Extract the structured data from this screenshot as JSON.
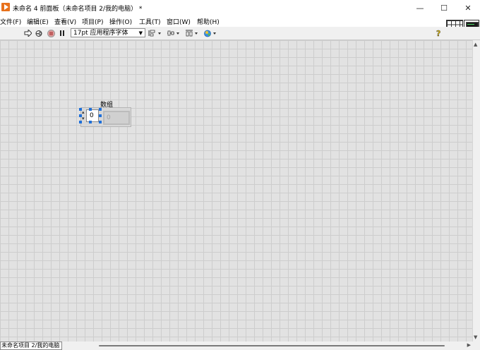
{
  "window": {
    "title": "未命名 4 前面板（未命名项目 2/我的电脑） *",
    "controls": {
      "minimize": "—",
      "maximize": "☐",
      "close": "✕"
    }
  },
  "menu": [
    "文件(F)",
    "编辑(E)",
    "查看(V)",
    "项目(P)",
    "操作(O)",
    "工具(T)",
    "窗口(W)",
    "帮助(H)"
  ],
  "toolbar": {
    "run_icon": "run-arrow-icon",
    "run_continuously_icon": "run-continuously-icon",
    "abort_icon": "abort-icon",
    "pause_icon": "pause-icon",
    "font_select": "17pt 应用程序字体",
    "align_icon": "align-objects-icon",
    "distribute_icon": "distribute-objects-icon",
    "resize_icon": "resize-objects-icon",
    "reorder_icon": "reorder-icon",
    "help_icon": "context-help-icon",
    "accent_color": "#1e6fd9"
  },
  "front_panel": {
    "array_label": "数组",
    "index_value": "0",
    "element_value": "0"
  },
  "status": {
    "project_path": "未命名项目 2/我的电脑"
  }
}
